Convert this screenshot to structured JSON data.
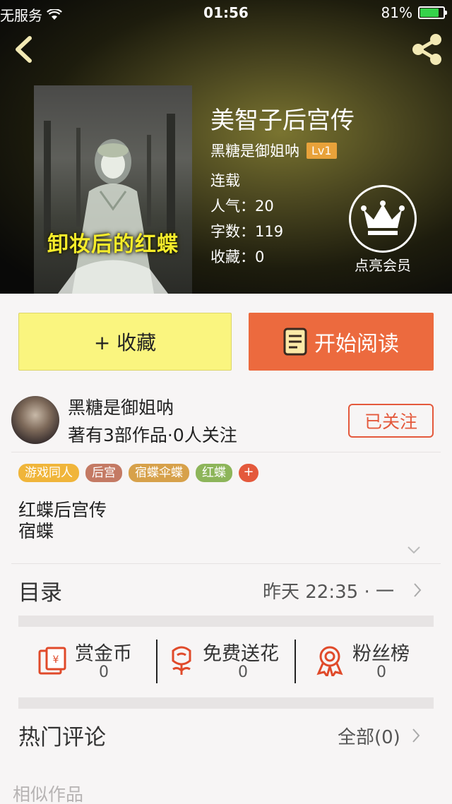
{
  "status_bar": {
    "carrier": "无服务",
    "time": "01:56",
    "battery": "81%",
    "battery_level": 0.81
  },
  "header": {
    "back_icon": "chevron-left-icon",
    "share_icon": "share-icon",
    "cover_text": "卸妆后的红蝶",
    "book_title": "美智子后宫传",
    "author": "黑糖是御姐呐",
    "level": "Lv1",
    "status": "连载",
    "popularity": "人气：20",
    "word_count": "字数：119",
    "favorites": "收藏：0",
    "vip_label": "点亮会员",
    "vip_icon": "crown-icon"
  },
  "actions": {
    "favorite": "+ 收藏",
    "read": "开始阅读",
    "read_icon": "book-icon"
  },
  "author_card": {
    "name": "黑糖是御姐呐",
    "stats": "著有3部作品·0人关注",
    "follow": "已关注"
  },
  "tags": [
    {
      "label": "游戏同人",
      "color": "#f0b53a"
    },
    {
      "label": "后宫",
      "color": "#c47a64"
    },
    {
      "label": "宿蝶伞蝶",
      "color": "#d7a14a"
    },
    {
      "label": "红蝶",
      "color": "#8db55a"
    }
  ],
  "tag_add": "+",
  "description": {
    "line1": "红蝶后宫传",
    "line2": "宿蝶"
  },
  "toc": {
    "label": "目录",
    "update": "昨天 22:35 · 一"
  },
  "rewards": [
    {
      "label": "赏金币",
      "count": "0",
      "icon": "red-envelope-icon"
    },
    {
      "label": "免费送花",
      "count": "0",
      "icon": "flower-icon"
    },
    {
      "label": "粉丝榜",
      "count": "0",
      "icon": "medal-icon"
    }
  ],
  "comments": {
    "label": "热门评论",
    "all": "全部(0)"
  },
  "similar": {
    "label": "相似作品"
  },
  "colors": {
    "accent_orange": "#ec6a3e",
    "favorite_yellow": "#faf57f",
    "follow_red": "#e4593c"
  }
}
